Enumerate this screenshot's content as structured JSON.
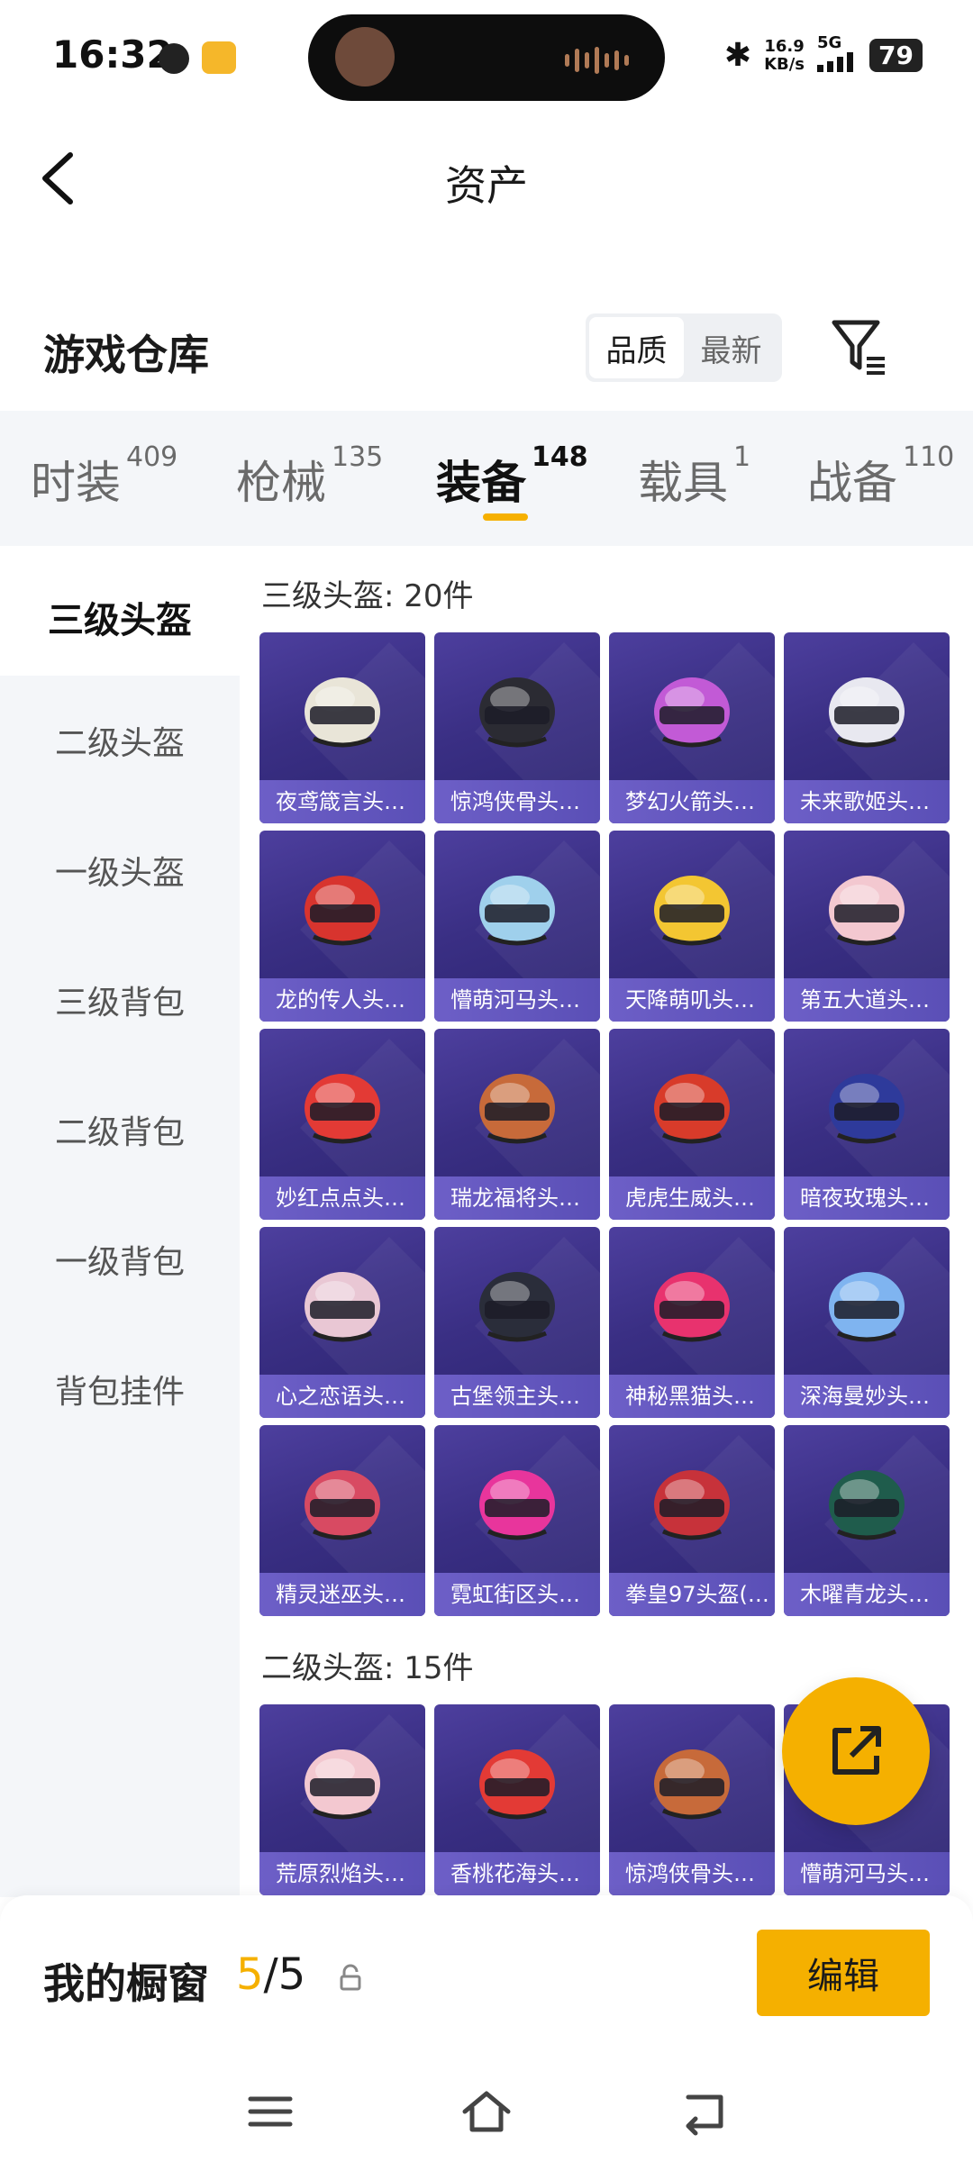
{
  "status_bar": {
    "time": "16:32",
    "network_speed_value": "16.9",
    "network_speed_unit": "KB/s",
    "network_type": "5G",
    "battery": "79"
  },
  "header": {
    "title": "资产"
  },
  "warehouse": {
    "title": "游戏仓库",
    "sort_options": [
      "品质",
      "最新"
    ],
    "active_sort": "品质"
  },
  "tabs": [
    {
      "label": "时装",
      "count": "409"
    },
    {
      "label": "枪械",
      "count": "135"
    },
    {
      "label": "装备",
      "count": "148"
    },
    {
      "label": "载具",
      "count": "1"
    },
    {
      "label": "战备",
      "count": "110"
    }
  ],
  "active_tab": "装备",
  "sidebar": {
    "items": [
      "三级头盔",
      "二级头盔",
      "一级头盔",
      "三级背包",
      "二级背包",
      "一级背包",
      "背包挂件"
    ],
    "active": "三级头盔"
  },
  "groups": [
    {
      "title": "三级头盔: 20件",
      "items": [
        "夜鸢箴言头…",
        "惊鸿侠骨头…",
        "梦幻火箭头…",
        "未来歌姬头…",
        "龙的传人头…",
        "懵萌河马头…",
        "天降萌叽头…",
        "第五大道头…",
        "妙红点点头…",
        "瑞龙福将头…",
        "虎虎生威头…",
        "暗夜玫瑰头…",
        "心之恋语头…",
        "古堡领主头…",
        "神秘黑猫头…",
        "深海曼妙头…",
        "精灵迷巫头…",
        "霓虹街区头…",
        "拳皇97头盔(…",
        "木曜青龙头…"
      ]
    },
    {
      "title": "二级头盔: 15件",
      "items": [
        "荒原烈焰头…",
        "香桃花海头…",
        "惊鸿侠骨头…",
        "懵萌河马头…"
      ]
    }
  ],
  "showcase": {
    "title": "我的橱窗",
    "current": "5",
    "total": "/5",
    "edit_label": "编辑"
  },
  "colors": {
    "accent": "#f5b000",
    "card_bg": "#3a2f84",
    "card_label": "#6d5fc7"
  }
}
